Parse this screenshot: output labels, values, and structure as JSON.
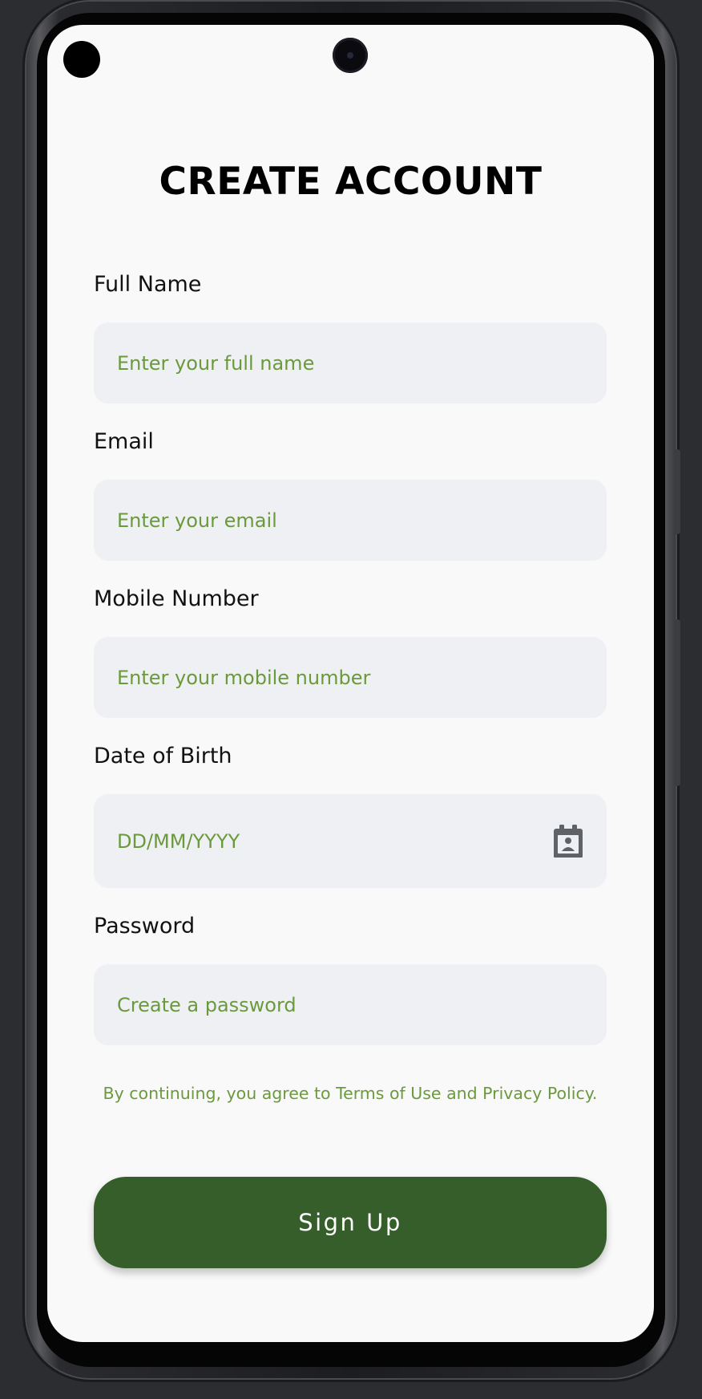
{
  "page": {
    "title": "CREATE ACCOUNT"
  },
  "fields": {
    "full_name": {
      "label": "Full Name",
      "placeholder": "Enter your full name"
    },
    "email": {
      "label": "Email",
      "placeholder": "Enter your email"
    },
    "mobile": {
      "label": "Mobile Number",
      "placeholder": "Enter your mobile number"
    },
    "dob": {
      "label": "Date of Birth",
      "placeholder": "DD/MM/YYYY",
      "icon": "calendar-icon"
    },
    "password": {
      "label": "Password",
      "placeholder": "Create a password"
    }
  },
  "terms_text": "By continuing, you agree to Terms of Use and Privacy Policy.",
  "signup_label": "Sign Up",
  "colors": {
    "accent_green": "#6a9a3c",
    "button_green": "#365e2b",
    "field_bg": "#eff0f3",
    "screen_bg": "#f9f9f9",
    "backdrop": "#2c2d31"
  }
}
